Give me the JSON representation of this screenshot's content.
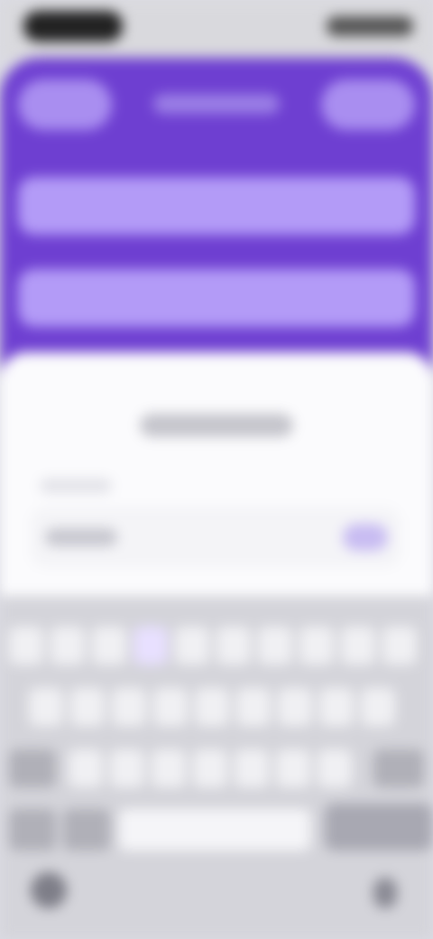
{
  "status_bar": {
    "time": "",
    "indicators": ""
  },
  "header": {
    "left_button": "",
    "title": "",
    "right_button": ""
  },
  "fields": [
    {
      "value": ""
    },
    {
      "value": ""
    }
  ],
  "sheet": {
    "title": "",
    "field_label": "",
    "input_value": "",
    "input_action": ""
  },
  "keyboard": {
    "row1": [
      "q",
      "w",
      "e",
      "r",
      "t",
      "y",
      "u",
      "i",
      "o",
      "p"
    ],
    "row2": [
      "a",
      "s",
      "d",
      "f",
      "g",
      "h",
      "j",
      "k",
      "l"
    ],
    "row3": [
      "z",
      "x",
      "c",
      "v",
      "b",
      "n",
      "m"
    ],
    "numbers_key": "123",
    "emoji_key": "",
    "space_label": "",
    "return_label": ""
  },
  "icons": [
    "shift-icon",
    "delete-icon",
    "globe-icon",
    "mic-icon",
    "emoji-icon"
  ]
}
